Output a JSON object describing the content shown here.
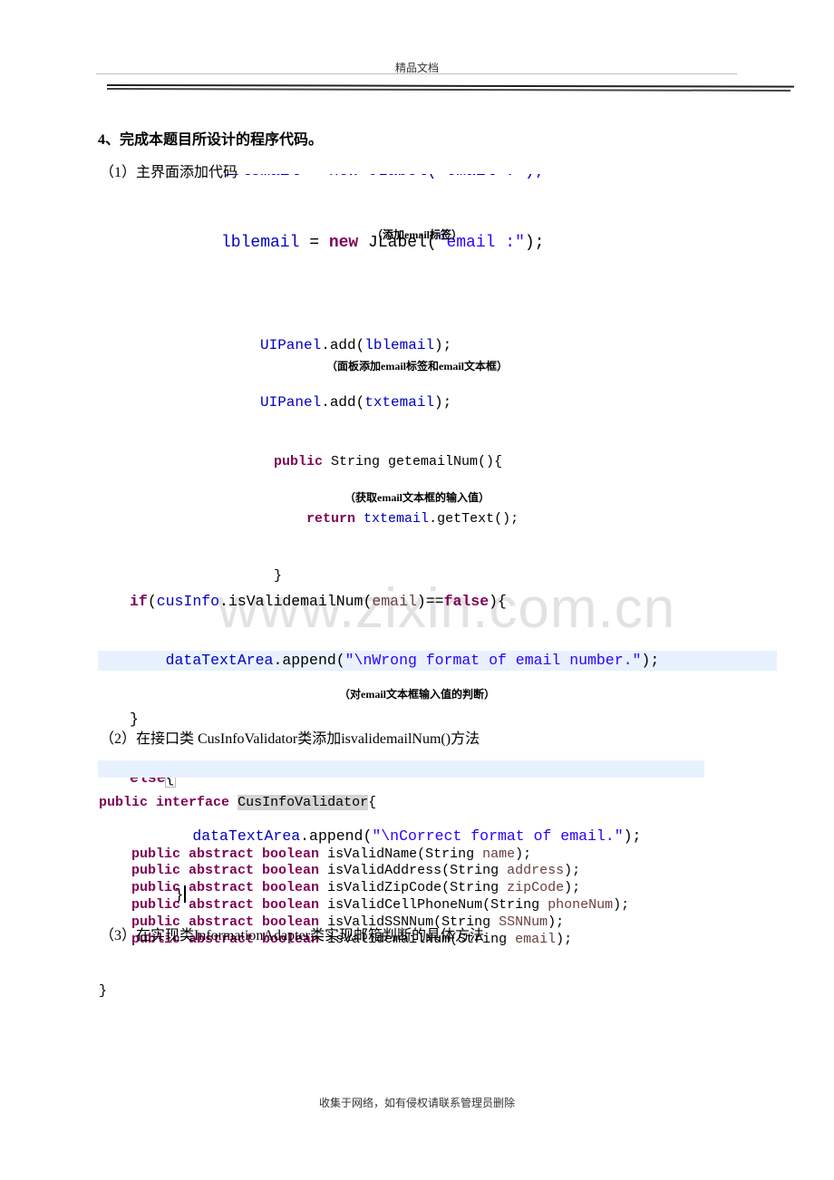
{
  "header": {
    "text": "精品文档"
  },
  "section": {
    "title": "4、完成本题目所设计的程序代码。",
    "part1": {
      "label": "（1）主界面添加代码",
      "snippet1": {
        "clipped_line": "lblemail = new JLabel(\"email :\");",
        "line": {
          "field": "lblemail",
          "op": " = ",
          "kw": "new",
          "cls": " JLabel(",
          "str": "\"email :\"",
          "end": ");"
        },
        "caption": "（添加email标签）"
      },
      "snippet2": {
        "lines": [
          {
            "obj": "UIPanel",
            "mid": ".add(",
            "arg": "lblemail",
            "end": ");"
          },
          {
            "obj": "UIPanel",
            "mid": ".add(",
            "arg": "txtemail",
            "end": ");"
          }
        ],
        "caption": "（面板添加email标签和email文本框）"
      },
      "snippet3": {
        "l1": {
          "kw": "public",
          "rest": " String getemailNum(){"
        },
        "l2": {
          "kw": "return",
          "field": "txtemail",
          "rest": ".getText();"
        },
        "l3": "}",
        "caption": "（获取email文本框的输入值）"
      },
      "snippet4": {
        "l1": {
          "kw1": "if",
          "p1": "(",
          "field": "cusInfo",
          "method": ".isValidemailNum(",
          "prm": "email",
          "op": ")==",
          "kw2": "false",
          "end": "){"
        },
        "l2": {
          "field": "dataTextArea",
          "method": ".append(",
          "str": "\"\\nWrong format of email number.\"",
          "end": ");"
        },
        "l3": "}",
        "l4": {
          "kw": "else",
          "brace": "{"
        },
        "l5": {
          "field": "dataTextArea",
          "method": ".append(",
          "str": "\"\\nCorrect format of email.\"",
          "end": ");"
        },
        "l6": "}",
        "caption": "（对email文本框输入值的判断）"
      }
    },
    "part2": {
      "label": "（2）在接口类 CusInfoValidator类添加isvalidemailNum()方法",
      "header": {
        "kw1": "public",
        "kw2": "interface",
        "name": "CusInfoValidator",
        "brace": "{"
      },
      "methods": [
        {
          "kw": "public abstract boolean",
          "name": " isValidName(String ",
          "param": "name",
          "end": ");"
        },
        {
          "kw": "public abstract boolean",
          "name": " isValidAddress(String ",
          "param": "address",
          "end": ");"
        },
        {
          "kw": "public abstract boolean",
          "name": " isValidZipCode(String ",
          "param": "zipCode",
          "end": ");"
        },
        {
          "kw": "public abstract boolean",
          "name": " isValidCellPhoneNum(String ",
          "param": "phoneNum",
          "end": ");"
        },
        {
          "kw": "public abstract boolean",
          "name": " isValidSSNNum(String ",
          "param": "SSNNum",
          "end": ");"
        },
        {
          "kw": "public abstract boolean",
          "name": " isValidemailNum(String ",
          "param": "email",
          "end": ");"
        }
      ],
      "closing": "}"
    },
    "part3": {
      "label": "（3）在实现类InformationAdapter类实现邮箱判断的具体方法"
    }
  },
  "watermark": "www.zixin.com.cn",
  "footer": {
    "text": "收集于网络，如有侵权请联系管理员删除"
  }
}
